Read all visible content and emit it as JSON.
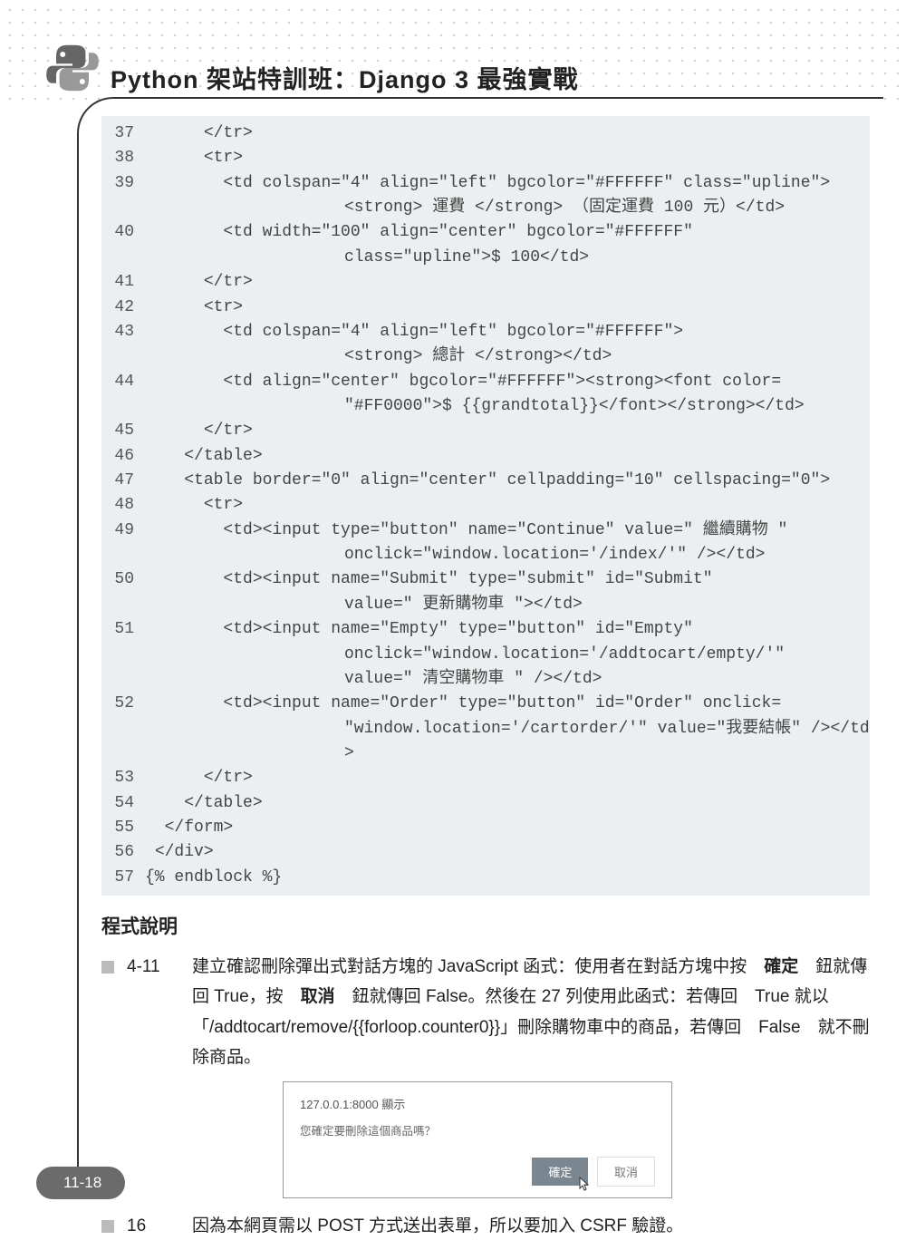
{
  "header": {
    "title": "Python 架站特訓班：Django 3 最強實戰"
  },
  "code": {
    "lines": [
      {
        "n": "37",
        "indent": "      ",
        "t": "</tr>"
      },
      {
        "n": "38",
        "indent": "      ",
        "t": "<tr>"
      },
      {
        "n": "39",
        "indent": "        ",
        "t": "<td colspan=\"4\" align=\"left\" bgcolor=\"#FFFFFF\" class=\"upline\">"
      },
      {
        "n": "",
        "indent": "",
        "cont": true,
        "t": "<strong> 運費 </strong> （固定運費 100 元）</td>"
      },
      {
        "n": "40",
        "indent": "        ",
        "t": "<td width=\"100\" align=\"center\" bgcolor=\"#FFFFFF\""
      },
      {
        "n": "",
        "indent": "",
        "cont": true,
        "t": "class=\"upline\">$ 100</td>"
      },
      {
        "n": "41",
        "indent": "      ",
        "t": "</tr>"
      },
      {
        "n": "42",
        "indent": "      ",
        "t": "<tr>"
      },
      {
        "n": "43",
        "indent": "        ",
        "t": "<td colspan=\"4\" align=\"left\" bgcolor=\"#FFFFFF\">"
      },
      {
        "n": "",
        "indent": "",
        "cont": true,
        "t": "<strong> 總計 </strong></td>"
      },
      {
        "n": "44",
        "indent": "        ",
        "t": "<td align=\"center\" bgcolor=\"#FFFFFF\"><strong><font color="
      },
      {
        "n": "",
        "indent": "",
        "cont": true,
        "t": "\"#FF0000\">$ {{grandtotal}}</font></strong></td>"
      },
      {
        "n": "45",
        "indent": "      ",
        "t": "</tr>"
      },
      {
        "n": "46",
        "indent": "    ",
        "t": "</table>"
      },
      {
        "n": "47",
        "indent": "    ",
        "t": "<table border=\"0\" align=\"center\" cellpadding=\"10\" cellspacing=\"0\">"
      },
      {
        "n": "48",
        "indent": "      ",
        "t": "<tr>"
      },
      {
        "n": "49",
        "indent": "        ",
        "t": "<td><input type=\"button\" name=\"Continue\" value=\" 繼續購物 \""
      },
      {
        "n": "",
        "indent": "",
        "cont": true,
        "t": "onclick=\"window.location='/index/'\" /></td>"
      },
      {
        "n": "50",
        "indent": "        ",
        "t": "<td><input name=\"Submit\" type=\"submit\" id=\"Submit\""
      },
      {
        "n": "",
        "indent": "",
        "cont": true,
        "t": "value=\" 更新購物車 \"></td>"
      },
      {
        "n": "51",
        "indent": "        ",
        "t": "<td><input name=\"Empty\" type=\"button\" id=\"Empty\""
      },
      {
        "n": "",
        "indent": "",
        "cont": true,
        "t": "onclick=\"window.location='/addtocart/empty/'\""
      },
      {
        "n": "",
        "indent": "",
        "cont": true,
        "t": "value=\" 清空購物車 \" /></td>"
      },
      {
        "n": "52",
        "indent": "        ",
        "t": "<td><input name=\"Order\" type=\"button\" id=\"Order\" onclick="
      },
      {
        "n": "",
        "indent": "",
        "cont": true,
        "t": "\"window.location='/cartorder/'\" value=\"我要結帳\" /></td>"
      },
      {
        "n": "53",
        "indent": "      ",
        "t": "</tr>"
      },
      {
        "n": "54",
        "indent": "    ",
        "t": "</table>"
      },
      {
        "n": "55",
        "indent": "  ",
        "t": "</form>"
      },
      {
        "n": "56",
        "indent": " ",
        "t": "</div>"
      },
      {
        "n": "57",
        "indent": "",
        "t": "{% endblock %}"
      }
    ]
  },
  "explain": {
    "heading": "程式說明",
    "items": [
      {
        "num": "4-11",
        "html": "建立確認刪除彈出式對話方塊的 JavaScript 函式：使用者在對話方塊中按　<b>確定</b>　鈕就傳回 True，按　<b>取消</b>　鈕就傳回 False。然後在 27 列使用此函式：若傳回　True 就以「/addtocart/remove/{{forloop.counter0}}」刪除購物車中的商品，若傳回　False　就不刪除商品。"
      },
      {
        "num": "16",
        "html": "因為本網頁需以 POST 方式送出表單，所以要加入 CSRF 驗證。"
      }
    ]
  },
  "dialog": {
    "title": "127.0.0.1:8000 顯示",
    "message": "您確定要刪除這個商品嗎？",
    "ok": "確定",
    "cancel": "取消"
  },
  "pagenum": "11-18"
}
